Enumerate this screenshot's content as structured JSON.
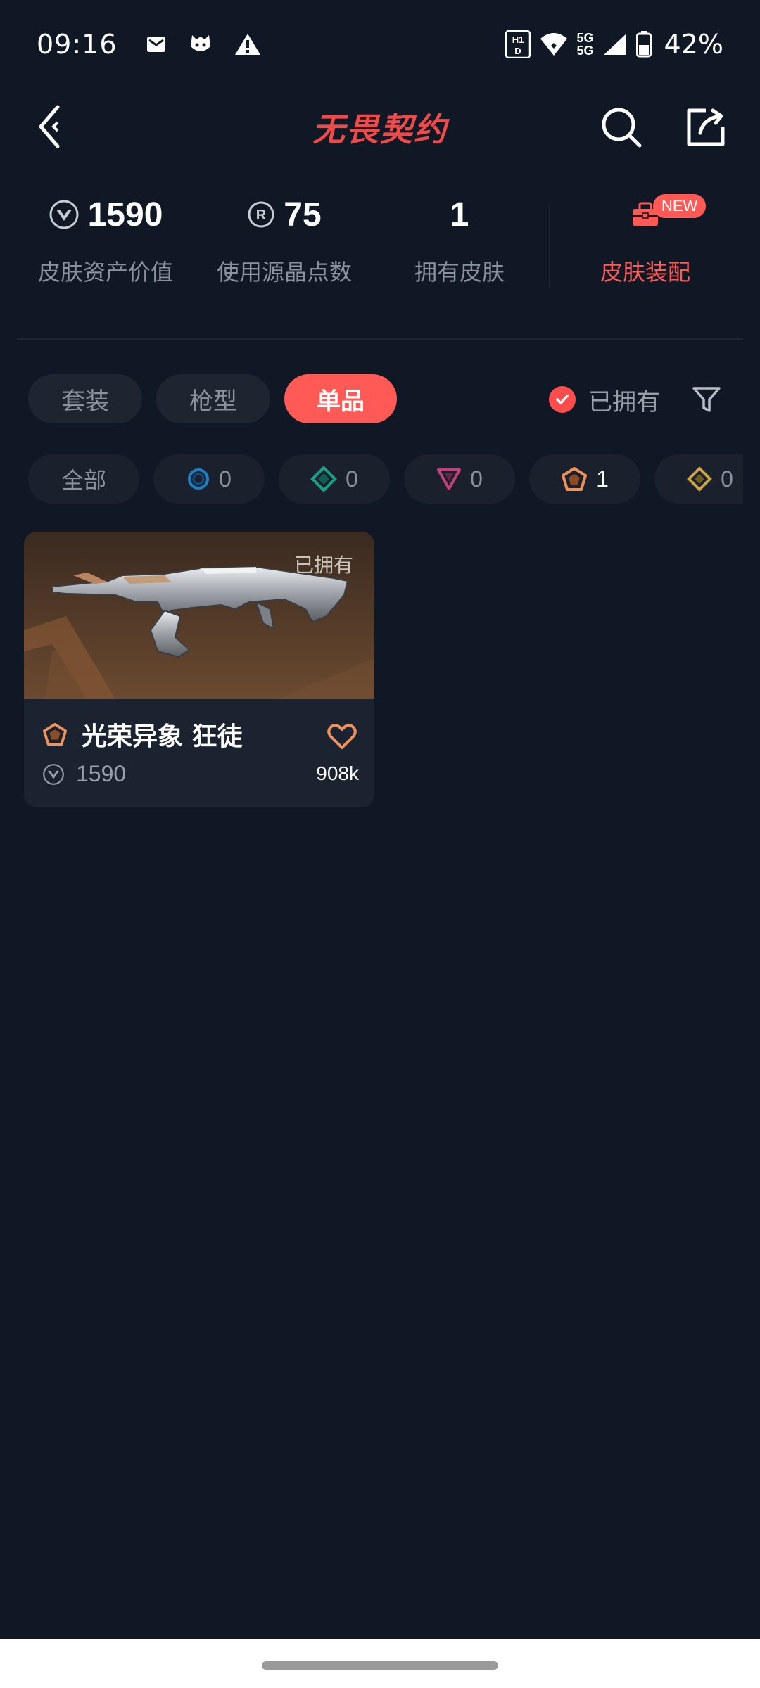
{
  "status_bar": {
    "time": "09:16",
    "battery": "42%",
    "network": "5G",
    "network2": "5G",
    "left_icons": [
      "mail-icon",
      "shield-app-icon",
      "warning-icon"
    ],
    "right_icons": [
      "hd-icon",
      "wifi-icon",
      "signal-icon",
      "battery-icon"
    ]
  },
  "header": {
    "logo_text": "无畏契约",
    "back_icon": "back-icon",
    "search_icon": "search-icon",
    "share_icon": "share-icon",
    "accent_color": "#ee4a4a"
  },
  "stats": {
    "asset_value": {
      "value": "1590",
      "label": "皮肤资产价值",
      "icon": "vp-currency-icon"
    },
    "radianite": {
      "value": "75",
      "label": "使用源晶点数",
      "icon": "radianite-icon"
    },
    "owned_skins": {
      "value": "1",
      "label": "拥有皮肤"
    },
    "skin_config": {
      "label": "皮肤装配",
      "badge": "NEW",
      "icon": "toolbox-icon"
    }
  },
  "tabs": [
    {
      "label": "套装",
      "active": false
    },
    {
      "label": "枪型",
      "active": false
    },
    {
      "label": "单品",
      "active": true
    }
  ],
  "owned_filter": {
    "label": "已拥有",
    "checked": true
  },
  "filter_icon": "filter-icon",
  "rarity_chips": [
    {
      "label": "全部",
      "icon": ""
    },
    {
      "count": "0",
      "icon": "circle-tier-icon",
      "color": "#1f7fc4"
    },
    {
      "count": "0",
      "icon": "diamond-tier-icon",
      "color": "#1aa08a"
    },
    {
      "count": "0",
      "icon": "triangle-tier-icon",
      "color": "#c2407b"
    },
    {
      "count": "1",
      "icon": "pentagon-tier-icon",
      "color": "#f0935a"
    },
    {
      "count": "0",
      "icon": "rhombus-tier-icon",
      "color": "#c9a64a"
    }
  ],
  "items": [
    {
      "name": "光荣异象 狂徒",
      "owned_label": "已拥有",
      "price": "1590",
      "likes": "908k",
      "rarity_icon": "pentagon-tier-icon",
      "rarity_color": "#f0935a"
    }
  ],
  "colors": {
    "background": "#111825",
    "accent": "#ff5a55",
    "chip_bg": "#1a212d",
    "muted_text": "#8b919d"
  }
}
